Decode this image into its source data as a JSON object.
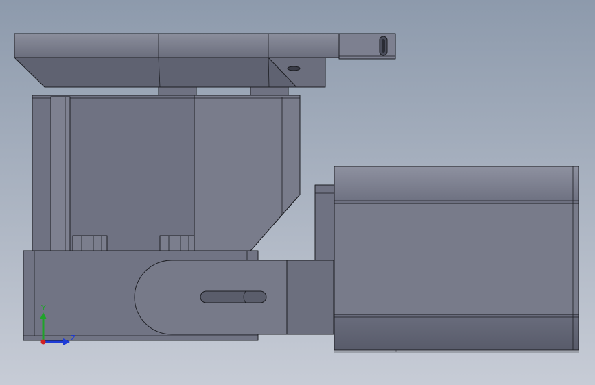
{
  "viewport": {
    "background_top": "#8d9aac",
    "background_bottom": "#c7ccd6"
  },
  "part_colors": {
    "face_light": "#7c7f8e",
    "face_mid": "#6e7181",
    "face_dark": "#5b5e6d",
    "face_top": "#9a9cab",
    "edge": "#1c1d22"
  },
  "triad": {
    "y_label": "Y",
    "z_label": "Z",
    "y_color": "#1fa32a",
    "z_color": "#1e3bd6",
    "origin_color": "#d21f1f"
  }
}
